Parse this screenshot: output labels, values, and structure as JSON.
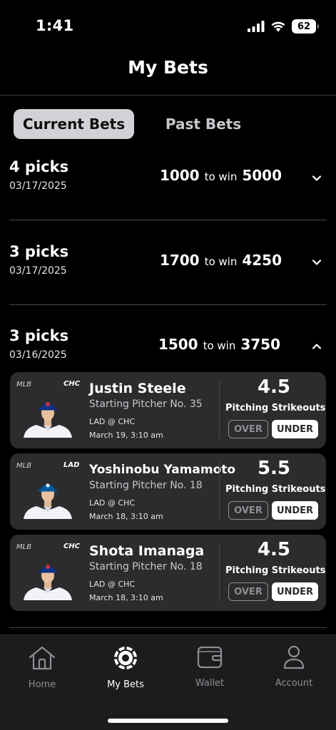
{
  "status_bar": {
    "time": "1:41",
    "battery": "62"
  },
  "header": {
    "title": "My Bets"
  },
  "tabs": [
    {
      "label": "Current Bets",
      "active": true
    },
    {
      "label": "Past Bets",
      "active": false
    }
  ],
  "bets": [
    {
      "picks": "4 picks",
      "date": "03/17/2025",
      "stake": "1000",
      "to_win_label": "to win",
      "payout": "5000",
      "expanded": false
    },
    {
      "picks": "3 picks",
      "date": "03/17/2025",
      "stake": "1700",
      "to_win_label": "to win",
      "payout": "4250",
      "expanded": false
    },
    {
      "picks": "3 picks",
      "date": "03/16/2025",
      "stake": "1500",
      "to_win_label": "to win",
      "payout": "3750",
      "expanded": true
    }
  ],
  "picks": [
    {
      "league": "MLB",
      "team": "CHC",
      "name": "Justin Steele",
      "role": "Starting Pitcher No. 35",
      "matchup": "LAD @ CHC",
      "time": "March 19, 3:10 am",
      "line": "4.5",
      "stat": "Pitching Strikeouts",
      "over_label": "OVER",
      "under_label": "UNDER",
      "selected": "UNDER"
    },
    {
      "league": "MLB",
      "team": "LAD",
      "name": "Yoshinobu Yamamoto",
      "role": "Starting Pitcher No. 18",
      "matchup": "LAD @ CHC",
      "time": "March 18, 3:10 am",
      "line": "5.5",
      "stat": "Pitching Strikeouts",
      "over_label": "OVER",
      "under_label": "UNDER",
      "selected": "UNDER"
    },
    {
      "league": "MLB",
      "team": "CHC",
      "name": "Shota Imanaga",
      "role": "Starting Pitcher No. 18",
      "matchup": "LAD @ CHC",
      "time": "March 18, 3:10 am",
      "line": "4.5",
      "stat": "Pitching Strikeouts",
      "over_label": "OVER",
      "under_label": "UNDER",
      "selected": "UNDER"
    }
  ],
  "nav": [
    {
      "label": "Home",
      "icon": "home-icon",
      "active": false
    },
    {
      "label": "My Bets",
      "icon": "chip-icon",
      "active": true
    },
    {
      "label": "Wallet",
      "icon": "wallet-icon",
      "active": false
    },
    {
      "label": "Account",
      "icon": "person-icon",
      "active": false
    }
  ],
  "colors": {
    "background": "#000000",
    "card": "#2c2c2e",
    "nav": "#1c1c1e",
    "tab_active": "#d1d1d6",
    "cap_cubs": "#0e3386",
    "cap_dodgers": "#005a9c"
  }
}
